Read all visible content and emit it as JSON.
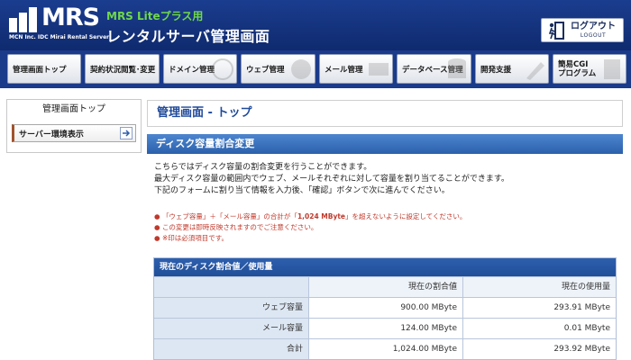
{
  "header": {
    "logo_text": "MRS",
    "logo_sub": "MCN Inc. IDC  Mirai Rental Server",
    "brand_sub": "MRS Liteプラス用",
    "brand_title": "レンタルサーバ管理画面",
    "logout_main": "ログアウト",
    "logout_sub": "LOGOUT"
  },
  "nav": {
    "tabs": [
      {
        "label": "管理画面トップ"
      },
      {
        "label": "契約状況閲覧･変更"
      },
      {
        "label": "ドメイン管理"
      },
      {
        "label": "ウェブ管理"
      },
      {
        "label": "メール管理"
      },
      {
        "label": "データベース管理"
      },
      {
        "label": "開発支援"
      },
      {
        "label": "簡易CGI",
        "label2": "プログラム"
      }
    ]
  },
  "sidebar": {
    "title": "管理画面トップ",
    "item": "サーバー環境表示"
  },
  "main": {
    "page_title": "管理画面 - トップ",
    "section_title": "ディスク容量割合変更",
    "desc": [
      "こちらではディスク容量の割合変更を行うことができます。",
      "最大ディスク容量の範囲内でウェブ、メールそれぞれに対して容量を割り当てることができます。",
      "下記のフォームに割り当て情報を入力後、「確認」ボタンで次に進んでください。"
    ],
    "notes": {
      "n1a": "「ウェブ容量」＋「メール容量」の合計が「",
      "n1b": "1,024 MByte",
      "n1c": "」を超えないように設定してください。",
      "n2": "この変更は即時反映されますのでご注意ください。",
      "n3": "※印は必須項目です。"
    },
    "table": {
      "title": "現在のディスク割合値／使用量",
      "col_alloc": "現在の割合値",
      "col_used": "現在の使用量",
      "rows": [
        {
          "label": "ウェブ容量",
          "alloc": "900.00 MByte",
          "used": "293.91 MByte"
        },
        {
          "label": "メール容量",
          "alloc": "124.00 MByte",
          "used": "0.01 MByte"
        },
        {
          "label": "合計",
          "alloc": "1,024.00 MByte",
          "used": "293.92 MByte"
        }
      ]
    }
  },
  "colors": {
    "header_bg": "#1b3d8f",
    "brand_green": "#6fd84a",
    "accent_blue": "#2c60ac",
    "note_red": "#c0392b"
  }
}
